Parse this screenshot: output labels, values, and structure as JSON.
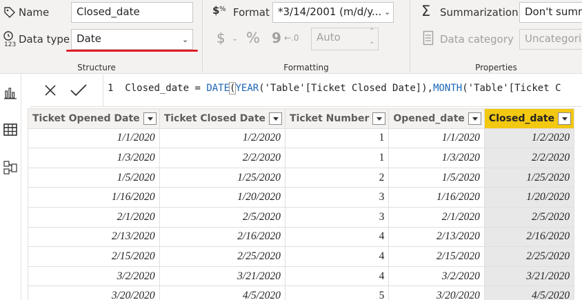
{
  "structure": {
    "name_label": "Name",
    "name_value": "Closed_date",
    "datatype_label": "Data type",
    "datatype_value": "Date",
    "group_label": "Structure"
  },
  "formatting": {
    "format_label": "Format",
    "format_value": "*3/14/2001 (m/d/y...",
    "currency_symbol": "$",
    "percent_symbol": "%",
    "comma_symbol": "9",
    "decimal_symbol": "←.0",
    "auto_value": "Auto",
    "group_label": "Formatting"
  },
  "properties": {
    "summarization_label": "Summarization",
    "summarization_value": "Don't summ",
    "datacategory_label": "Data category",
    "datacategory_value": "Uncategoriz",
    "group_label": "Properties"
  },
  "formula": {
    "line_number": "1",
    "prefix": "Closed_date = ",
    "fn1": "DATE",
    "open1": "(",
    "fn2": "YEAR",
    "arg1": "('Table'[Ticket Closed Date]),",
    "fn3": "MONTH",
    "arg2": "('Table'[Ticket C"
  },
  "table": {
    "columns": [
      "Ticket Opened Date",
      "Ticket Closed Date",
      "Ticket Number",
      "Opened_date",
      "Closed_date"
    ],
    "rows": [
      [
        "1/1/2020",
        "1/2/2020",
        "1",
        "1/1/2020",
        "1/2/2020"
      ],
      [
        "1/3/2020",
        "2/2/2020",
        "1",
        "1/3/2020",
        "2/2/2020"
      ],
      [
        "1/5/2020",
        "1/25/2020",
        "2",
        "1/5/2020",
        "1/25/2020"
      ],
      [
        "1/16/2020",
        "1/20/2020",
        "3",
        "1/16/2020",
        "1/20/2020"
      ],
      [
        "2/1/2020",
        "2/5/2020",
        "3",
        "2/1/2020",
        "2/5/2020"
      ],
      [
        "2/13/2020",
        "2/16/2020",
        "4",
        "2/13/2020",
        "2/16/2020"
      ],
      [
        "2/15/2020",
        "2/25/2020",
        "4",
        "2/15/2020",
        "2/25/2020"
      ],
      [
        "3/2/2020",
        "3/21/2020",
        "4",
        "3/2/2020",
        "3/21/2020"
      ],
      [
        "3/20/2020",
        "4/5/2020",
        "5",
        "3/20/2020",
        "4/5/2020"
      ]
    ]
  },
  "colors": {
    "active_column_header": "#f2c811",
    "datatype_underline": "#e01f26",
    "dax_function": "#1c66b7"
  }
}
